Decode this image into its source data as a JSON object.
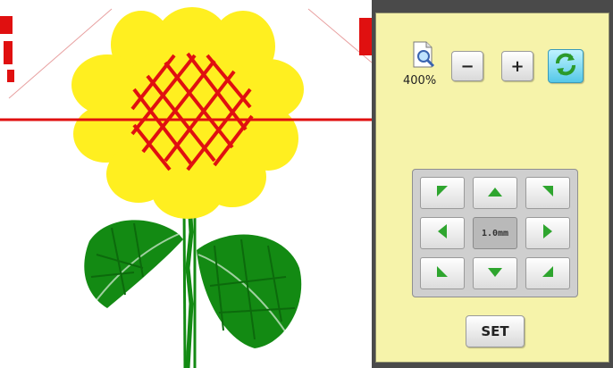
{
  "zoom": {
    "level_label": "400%"
  },
  "buttons": {
    "zoom_out": "−",
    "zoom_in": "+",
    "set": "SET"
  },
  "move_pad": {
    "step_label": "1.0mm"
  },
  "colors": {
    "panel_bg": "#f6f3aa",
    "arrow_green": "#2ea52e",
    "petal_yellow": "#ffef20",
    "stitch_red": "#e01010",
    "leaf_green": "#138a13"
  },
  "icons": {
    "zoom": "magnifier-icon",
    "refresh": "refresh-icon",
    "arrows": [
      "arrow-up-left-icon",
      "arrow-up-icon",
      "arrow-up-right-icon",
      "arrow-left-icon",
      "arrow-right-icon",
      "arrow-down-left-icon",
      "arrow-down-icon",
      "arrow-down-right-icon"
    ]
  }
}
